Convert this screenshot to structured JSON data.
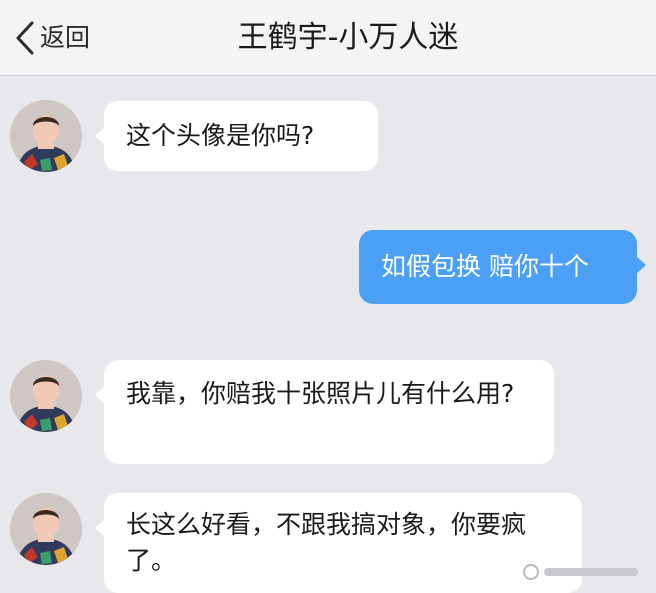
{
  "header": {
    "back_label": "返回",
    "title": "王鹤宇-小万人迷"
  },
  "messages": [
    {
      "side": "incoming",
      "text": "这个头像是你吗?"
    },
    {
      "side": "outgoing",
      "text": "如假包换 赔你十个"
    },
    {
      "side": "incoming",
      "text": "我靠，你赔我十张照片儿有什么用?"
    },
    {
      "side": "incoming",
      "text": "长这么好看，不跟我搞对象，你要疯了。"
    }
  ],
  "icons": {
    "back": "chevron-left-icon",
    "avatar": "avatar"
  },
  "colors": {
    "background": "#e7e7ec",
    "navbar": "#f4f4f6",
    "incoming_bubble": "#ffffff",
    "outgoing_bubble": "#4b9ff5"
  }
}
